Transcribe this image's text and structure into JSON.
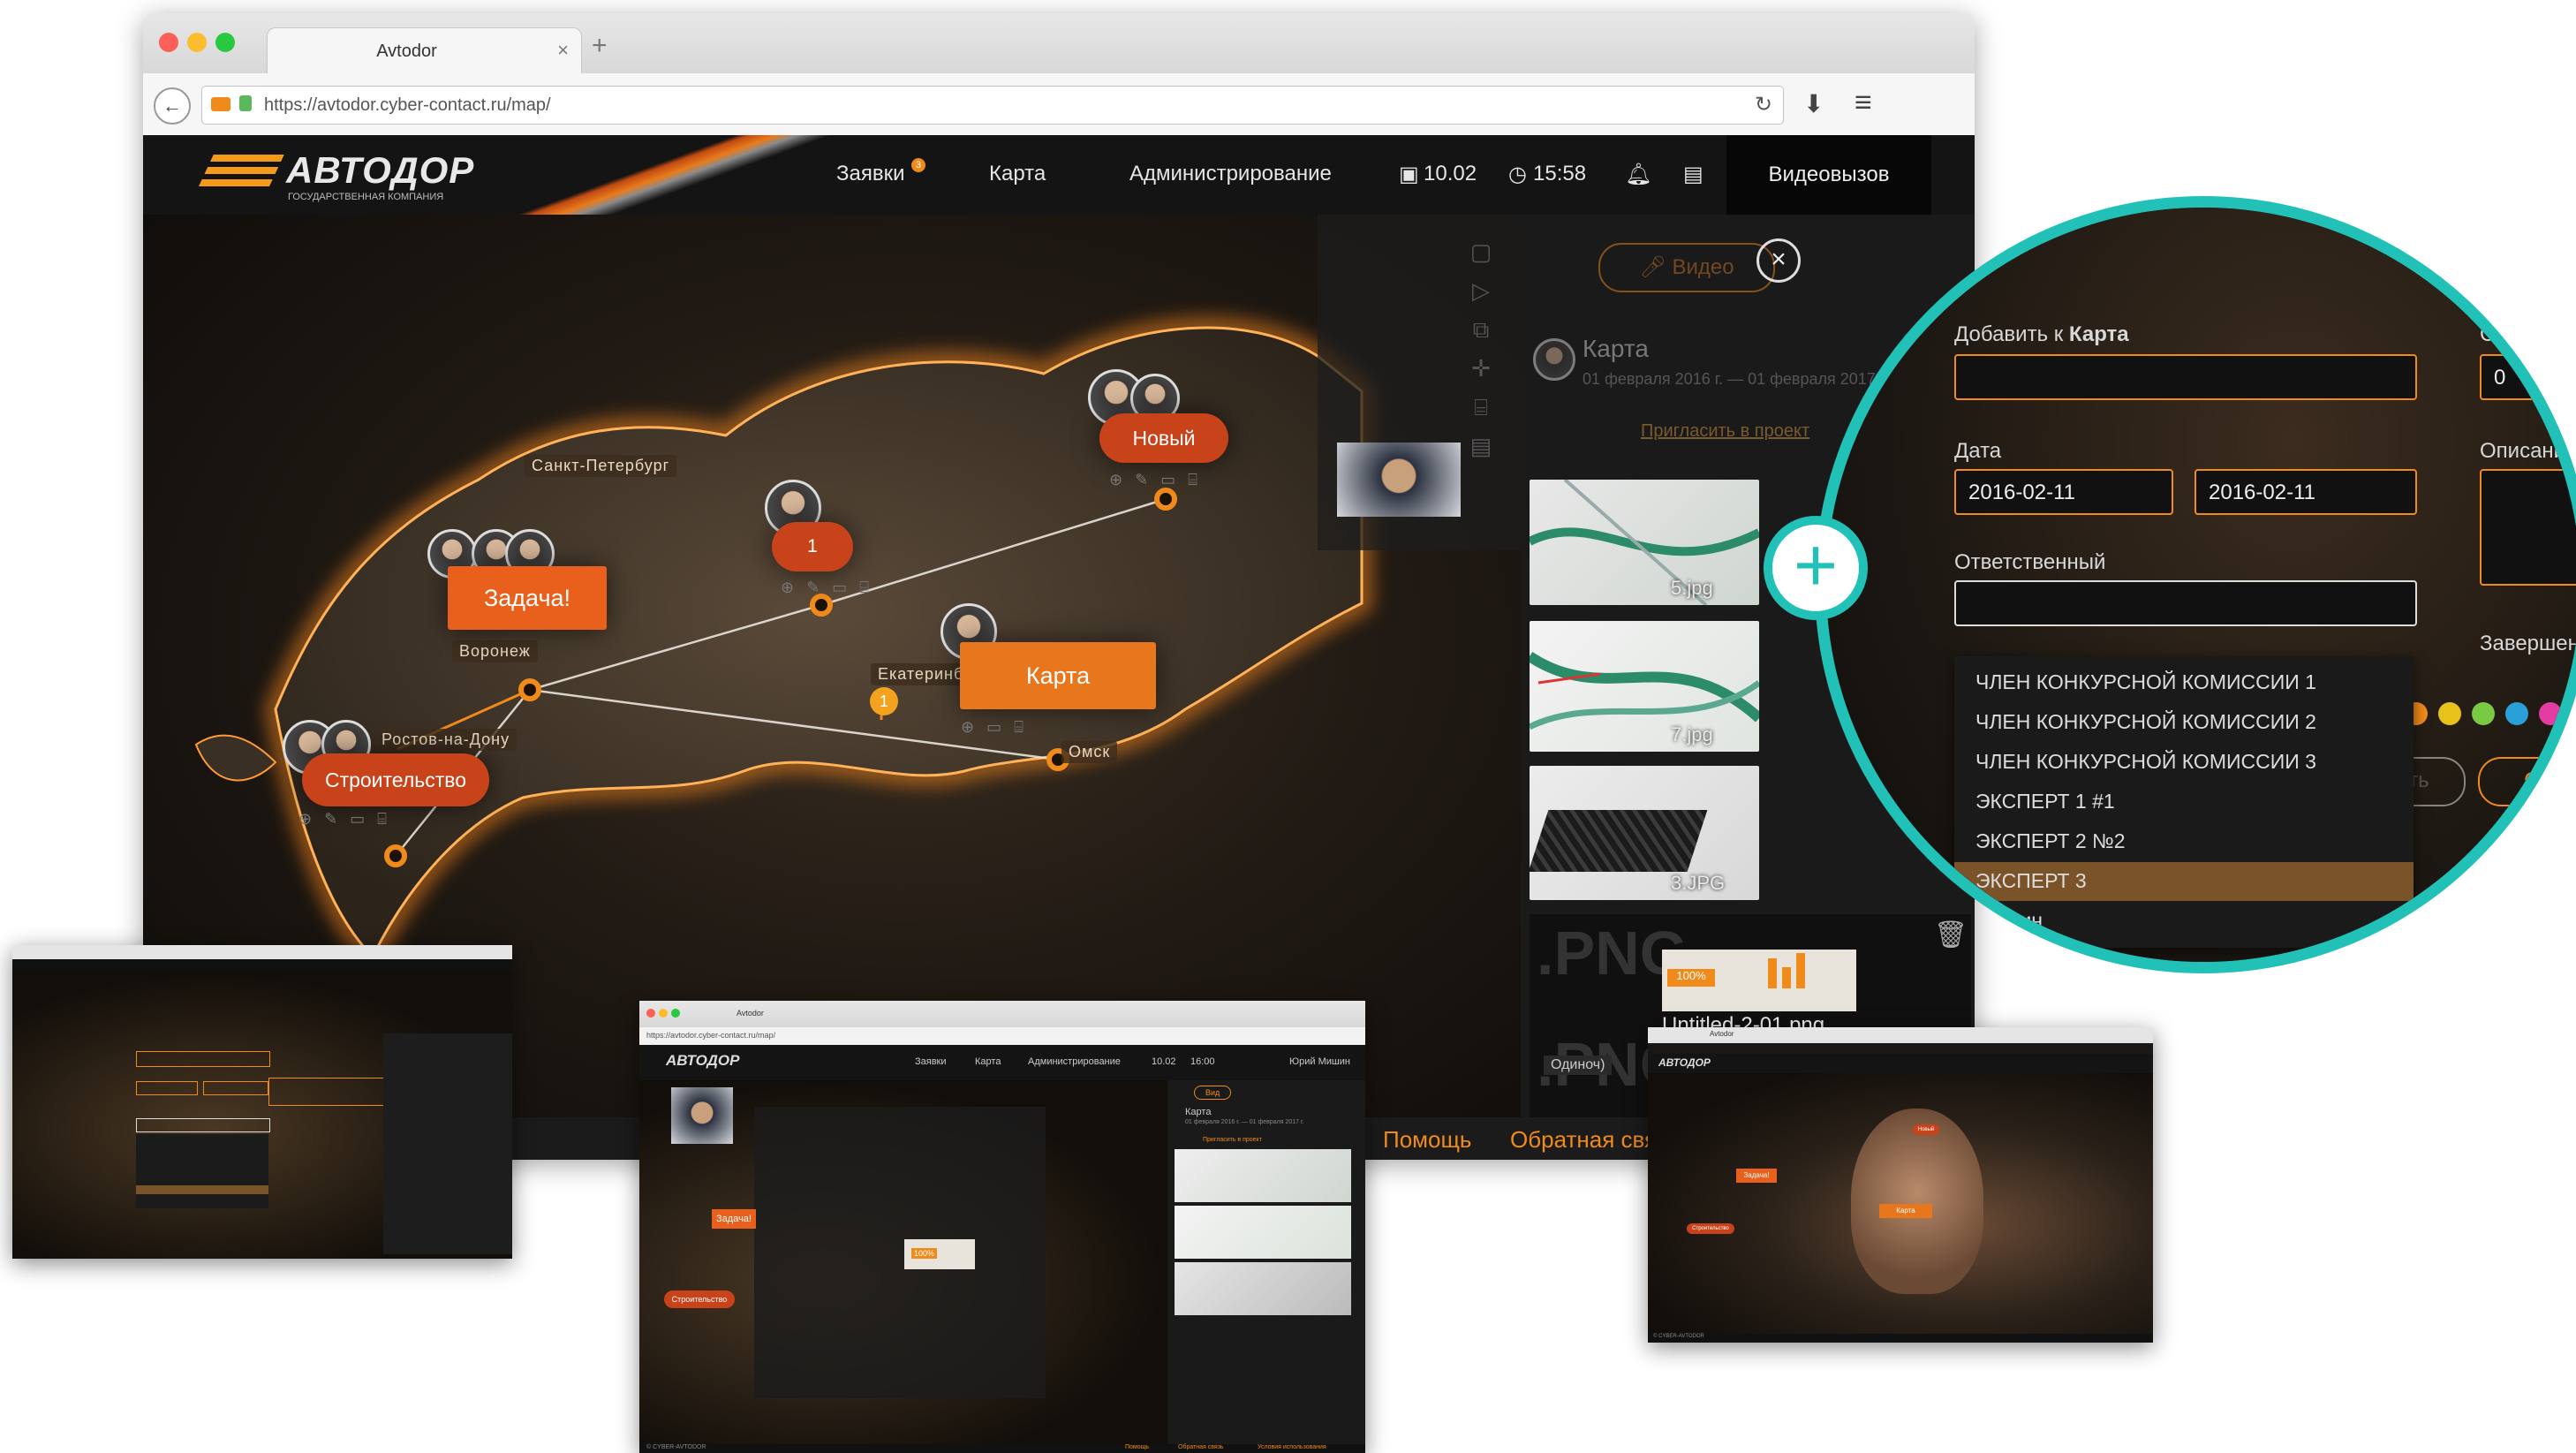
{
  "browser": {
    "tab_title": "Avtodor",
    "tab_close": "×",
    "new_tab": "+",
    "url": "https://avtodor.cyber-contact.ru/map/"
  },
  "app": {
    "logo": "АВТОДОР",
    "logo_sub": "ГОСУДАРСТВЕННАЯ КОМПАНИЯ",
    "nav": [
      "Заявки",
      "Карта",
      "Администрирование"
    ],
    "nav_badge": "3",
    "date": "10.02",
    "time": "15:58",
    "video_call": "Видеовызов"
  },
  "map": {
    "cities": [
      "Санкт-Петербург",
      "Воронеж",
      "Ростов-на-Дону",
      "Екатеринб",
      "Омск"
    ],
    "cards": {
      "task": "Задача!",
      "construction": "Строительство",
      "new": "Новый",
      "map": "Карта",
      "count": "1",
      "count_small": "1"
    }
  },
  "panel": {
    "video_btn": "Видео",
    "title": "Карта",
    "dates": "01 февраля 2016 г. — 01 февраля 2017",
    "invite": "Пригласить в проект",
    "files": [
      {
        "name": "5.jpg"
      },
      {
        "name": "7.jpg"
      },
      {
        "name": "3.JPG"
      },
      {
        "name": "Untitled-2-01.png"
      }
    ],
    "png_big": ".PNG",
    "odinoch": "Одиноч)",
    "progress": "100%"
  },
  "footer": {
    "help": "Помощь",
    "feedback": "Обратная свя"
  },
  "magnifier": {
    "add_to_label": "Добавить к",
    "add_to_target": "Карта",
    "date_label": "Дата",
    "date_from": "2016-02-11",
    "date_to": "2016-02-11",
    "responsible_label": "Ответственный",
    "right_label_1": "С",
    "right_value_1": "0",
    "description_label": "Описани",
    "completed_label": "Завершено",
    "create_btn": "Создать",
    "cancel_btn": "Отме",
    "dropdown": [
      "ЧЛЕН КОНКУРСНОЙ КОМИССИИ 1",
      "ЧЛЕН КОНКУРСНОЙ КОМИССИИ 2",
      "ЧЛЕН КОНКУРСНОЙ КОМИССИИ 3",
      "ЭКСПЕРТ 1 #1",
      "ЭКСПЕРТ 2 №2",
      "ЭКСПЕРТ 3",
      "Мишин"
    ],
    "dropdown_selected_index": 5,
    "colors": [
      "#f08a1a",
      "#e7c21b",
      "#7ac943",
      "#2a9fd8",
      "#e43ca0"
    ]
  },
  "mini_center": {
    "tab_title": "Avtodor",
    "url": "https://avtodor.cyber-contact.ru/map/",
    "logo": "АВТОДОР",
    "nav": [
      "Заявки",
      "Карта",
      "Администрирование"
    ],
    "date": "10.02",
    "time": "16:00",
    "user": "Юрий Мишин",
    "panel_btn": "Вид",
    "panel_title": "Карта",
    "panel_dates": "01 февраля 2016 г. — 01 февраля 2017 г.",
    "invite": "Пригласить в проект",
    "card_task": "Задача!",
    "card_construction": "Строительство",
    "progress": "100%",
    "footer_left": "© CYBER-AVTODOR",
    "footer_links": [
      "Помощь",
      "Обратная связь",
      "Условия использования"
    ]
  },
  "mini_right": {
    "tab_title": "Avtodor",
    "logo": "АВТОДОР",
    "card_task": "Задача!",
    "card_map": "Карта",
    "card_construction": "Строительство",
    "card_new": "Новый",
    "footer_left": "© CYBER-AVTODOR"
  }
}
